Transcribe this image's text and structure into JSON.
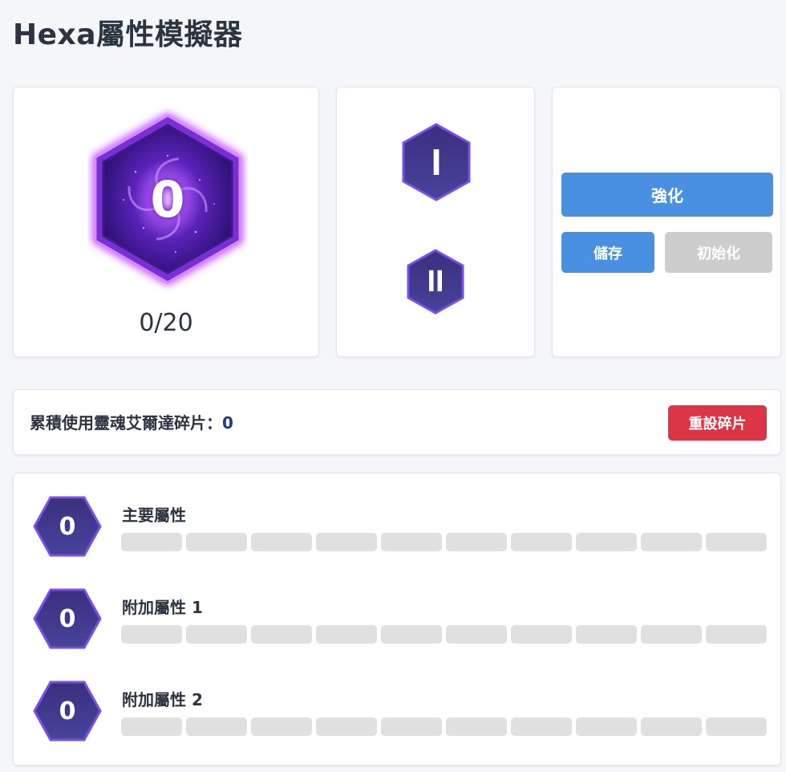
{
  "page": {
    "title": "Hexa屬性模擬器"
  },
  "main_hex": {
    "level": "0",
    "progress": "0/20"
  },
  "selector": {
    "option_1": "I",
    "option_2": "II"
  },
  "actions": {
    "enhance": "強化",
    "save": "儲存",
    "init": "初始化"
  },
  "fragments": {
    "label": "累積使用靈魂艾爾達碎片：",
    "value": "0",
    "reset": "重設碎片"
  },
  "stats": [
    {
      "name": "主要屬性",
      "level": "0",
      "filled": 0,
      "max": 10
    },
    {
      "name": "附加屬性 1",
      "level": "0",
      "filled": 0,
      "max": 10
    },
    {
      "name": "附加屬性 2",
      "level": "0",
      "filled": 0,
      "max": 10
    }
  ],
  "colors": {
    "primary": "#4a90e2",
    "danger": "#dc3545",
    "disabled": "#cdcdcd",
    "hex_purple": "#6a3fd0",
    "bar_empty": "#e0e0e0"
  }
}
